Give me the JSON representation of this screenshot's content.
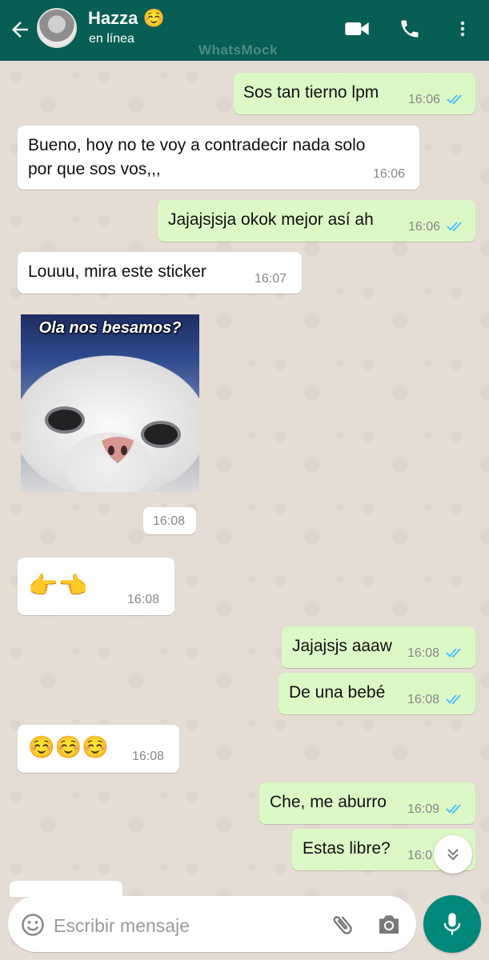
{
  "header": {
    "contact_name": "Hazza ☺️",
    "status": "en línea",
    "watermark": "WhatsMock",
    "icons": [
      "back-arrow-icon",
      "video-call-icon",
      "phone-icon",
      "more-vert-icon"
    ],
    "color": "#075e54"
  },
  "messages": [
    {
      "dir": "out",
      "text": "Sos tan tierno lpm",
      "time": "16:06",
      "read": true
    },
    {
      "dir": "in",
      "lines": [
        "Bueno, hoy no te voy a contradecir nada solo",
        "por que sos vos,,,"
      ],
      "time": "16:06"
    },
    {
      "dir": "out",
      "text": "Jajajsjsja okok mejor así ah",
      "time": "16:06",
      "read": true
    },
    {
      "dir": "in",
      "text": "Louuu, mira este sticker",
      "time": "16:07"
    },
    {
      "dir": "in",
      "type": "sticker",
      "sticker_text": "Ola nos besamos?",
      "time": "16:08"
    },
    {
      "dir": "in",
      "text": "👉👈",
      "time": "16:08"
    },
    {
      "dir": "out",
      "text": "Jajajsjs aaaw",
      "time": "16:08",
      "read": true
    },
    {
      "dir": "out",
      "text": "De una bebé",
      "time": "16:08",
      "read": true
    },
    {
      "dir": "in",
      "text": "☺️☺️☺️",
      "time": "16:08"
    },
    {
      "dir": "out",
      "text": "Che, me aburro",
      "time": "16:09",
      "read": true
    },
    {
      "dir": "out",
      "text": "Estas libre?",
      "time": "16:0"
    }
  ],
  "input": {
    "placeholder": "Escribir mensaje"
  },
  "colors": {
    "out_bubble": "#dcf8c6",
    "in_bubble": "#ffffff",
    "tick_read": "#4fc3f7",
    "mic_button": "#00897b"
  }
}
